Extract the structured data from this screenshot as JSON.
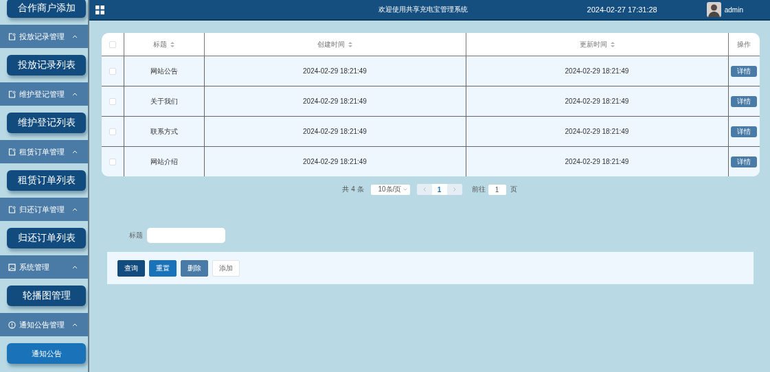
{
  "sidebar": {
    "items": [
      {
        "kind": "button",
        "label": "合作商户添加",
        "selected": false
      },
      {
        "kind": "group",
        "label": "投放记录管理",
        "expanded": true
      },
      {
        "kind": "button",
        "label": "投放记录列表",
        "selected": false
      },
      {
        "kind": "group",
        "label": "维护登记管理",
        "expanded": true
      },
      {
        "kind": "button",
        "label": "维护登记列表",
        "selected": false
      },
      {
        "kind": "group",
        "label": "租赁订单管理",
        "expanded": true
      },
      {
        "kind": "button",
        "label": "租赁订单列表",
        "selected": false
      },
      {
        "kind": "group",
        "label": "归还订单管理",
        "expanded": true
      },
      {
        "kind": "button",
        "label": "归还订单列表",
        "selected": false
      },
      {
        "kind": "group",
        "label": "系统管理",
        "expanded": true
      },
      {
        "kind": "button",
        "label": "轮播图管理",
        "selected": false
      },
      {
        "kind": "group",
        "label": "通知公告管理",
        "expanded": true
      },
      {
        "kind": "button",
        "label": "通知公告",
        "selected": true
      }
    ]
  },
  "header": {
    "title": "欢迎使用共享充电宝管理系统",
    "datetime": "2024-02-27 17:31:28",
    "user": "admin"
  },
  "table": {
    "select_all_checked": false,
    "columns": [
      {
        "label": "标题",
        "sortable": true
      },
      {
        "label": "创建时间",
        "sortable": true
      },
      {
        "label": "更新时间",
        "sortable": true
      },
      {
        "label": "操作",
        "sortable": false
      }
    ],
    "rows": [
      {
        "checked": false,
        "title": "网站公告",
        "created": "2024-02-29 18:21:49",
        "updated": "2024-02-29 18:21:49",
        "action": "详情"
      },
      {
        "checked": false,
        "title": "关于我们",
        "created": "2024-02-29 18:21:49",
        "updated": "2024-02-29 18:21:49",
        "action": "详情"
      },
      {
        "checked": false,
        "title": "联系方式",
        "created": "2024-02-29 18:21:49",
        "updated": "2024-02-29 18:21:49",
        "action": "详情"
      },
      {
        "checked": false,
        "title": "网站介绍",
        "created": "2024-02-29 18:21:49",
        "updated": "2024-02-29 18:21:49",
        "action": "详情"
      }
    ]
  },
  "pagination": {
    "total": "共 4 条",
    "page_size": "10条/页",
    "pages": [
      {
        "label": "1",
        "selected": true
      }
    ],
    "goto_label": "前往",
    "goto_value": "1",
    "goto_suffix": "页"
  },
  "search": {
    "label": "标题"
  },
  "buttons": [
    {
      "kind": "query",
      "label": "查询"
    },
    {
      "kind": "reset",
      "label": "重置"
    },
    {
      "kind": "delete",
      "label": "删除"
    },
    {
      "kind": "add",
      "label": "添加"
    }
  ]
}
